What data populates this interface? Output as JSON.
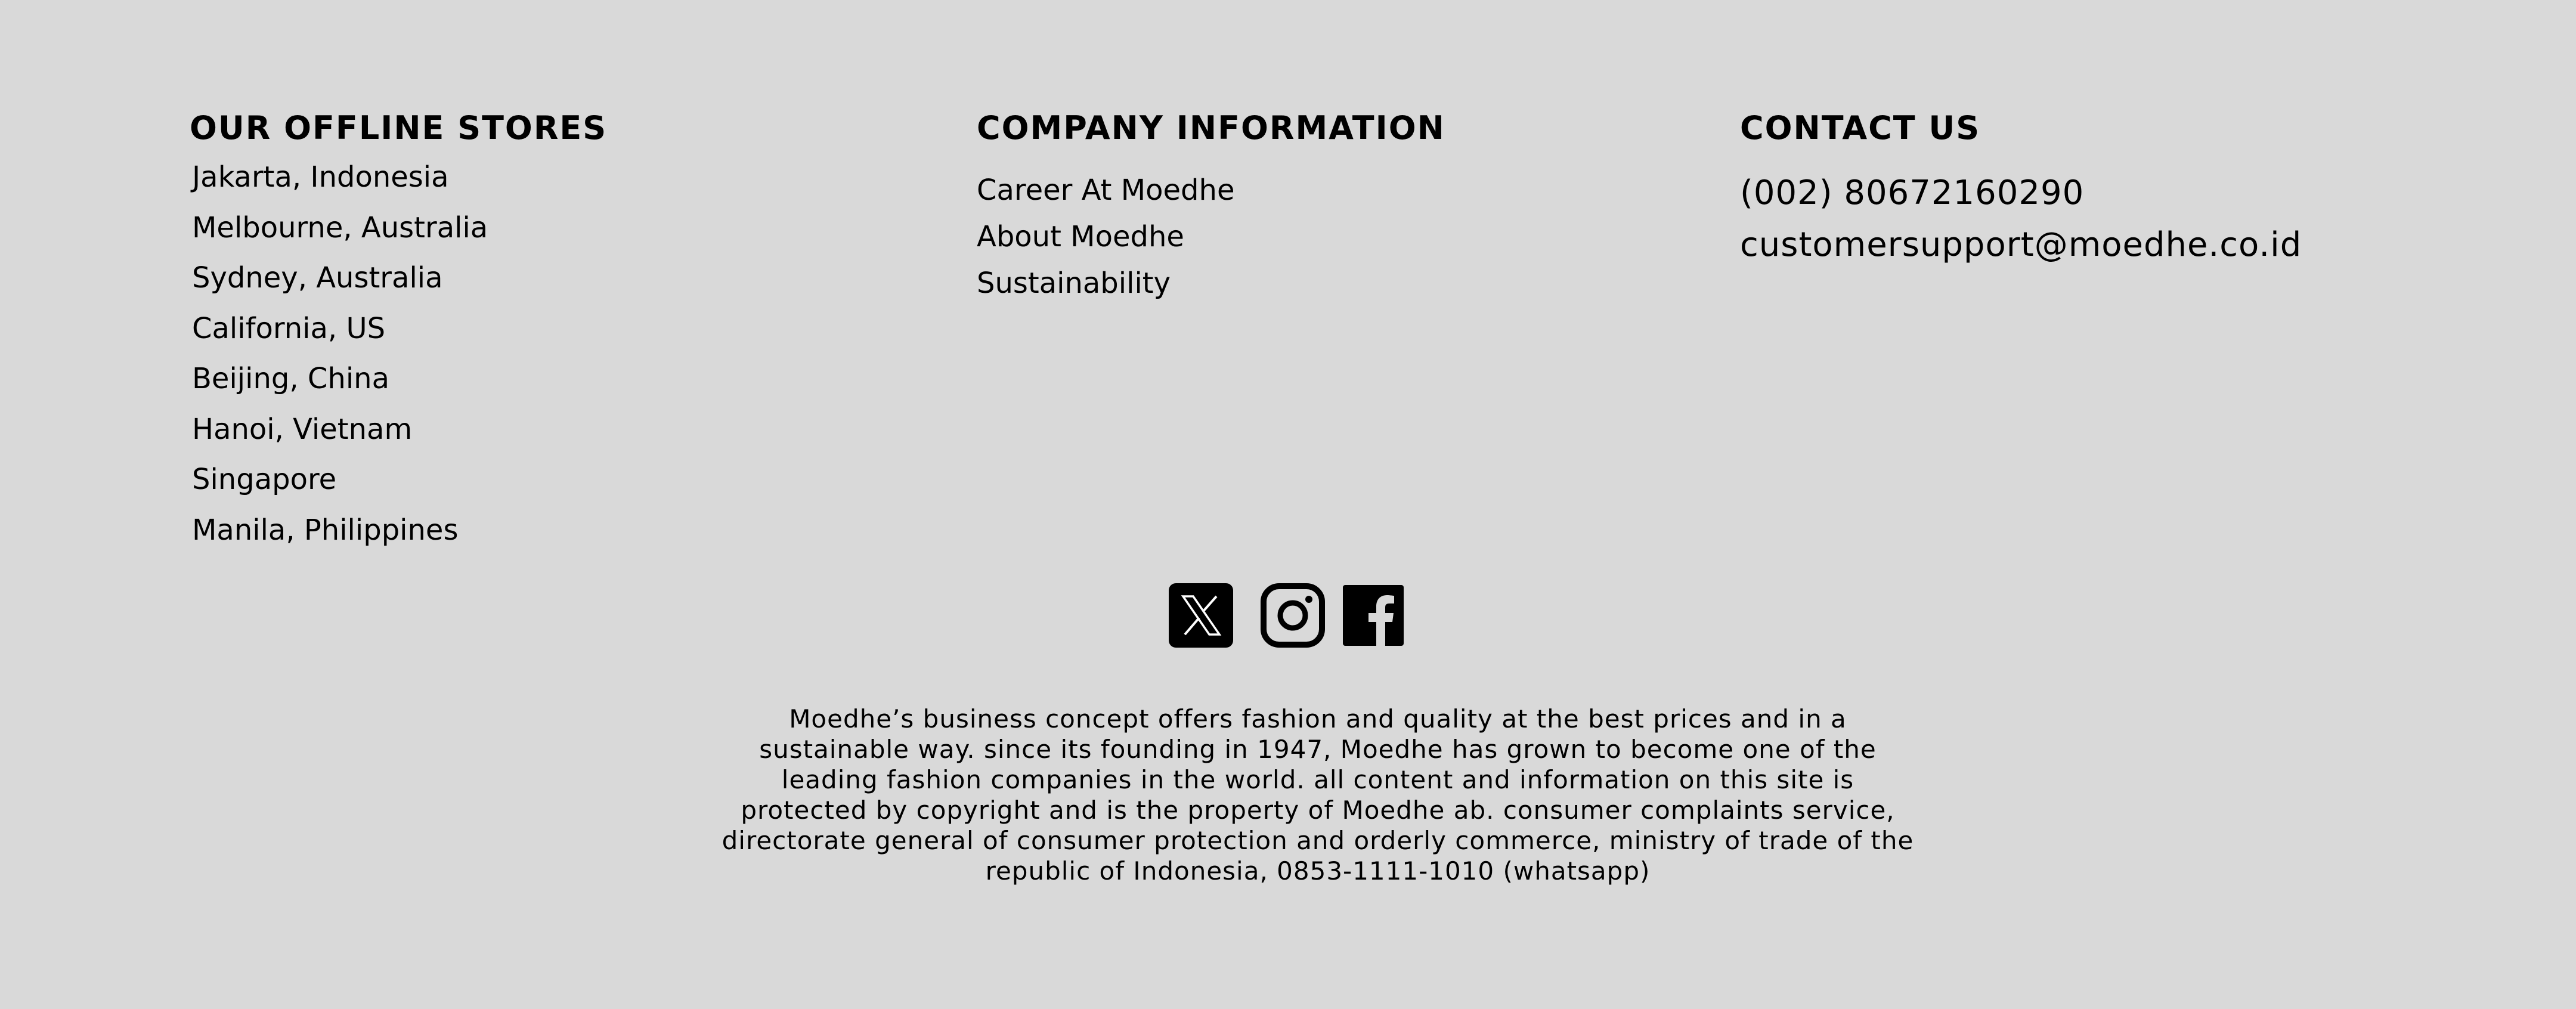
{
  "footer": {
    "stores": {
      "heading": "OUR OFFLINE STORES",
      "items": [
        "Jakarta, Indonesia",
        "Melbourne, Australia",
        "Sydney, Australia",
        "California, US",
        "Beijing, China",
        "Hanoi, Vietnam",
        "Singapore",
        "Manila, Philippines"
      ]
    },
    "company": {
      "heading": "COMPANY INFORMATION",
      "items": [
        "Career At Moedhe",
        "About Moedhe",
        "Sustainability"
      ]
    },
    "contact": {
      "heading": "CONTACT US",
      "phone": "(002) 80672160290",
      "email": "customersupport@moedhe.co.id"
    },
    "socials": [
      {
        "name": "x",
        "icon": "x-logo-icon"
      },
      {
        "name": "instagram",
        "icon": "instagram-icon"
      },
      {
        "name": "facebook",
        "icon": "facebook-icon"
      }
    ],
    "about_text": "Moedhe’s business concept offers fashion and quality at the best prices and in a sustainable way. since its founding in 1947, Moedhe has grown to become one of the leading fashion companies in the world. all content and information on this site is protected by copyright and is the property of Moedhe ab. consumer complaints service, directorate general of consumer protection and orderly commerce, ministry of trade of the republic of Indonesia, 0853-1111-1010 (whatsapp)"
  }
}
